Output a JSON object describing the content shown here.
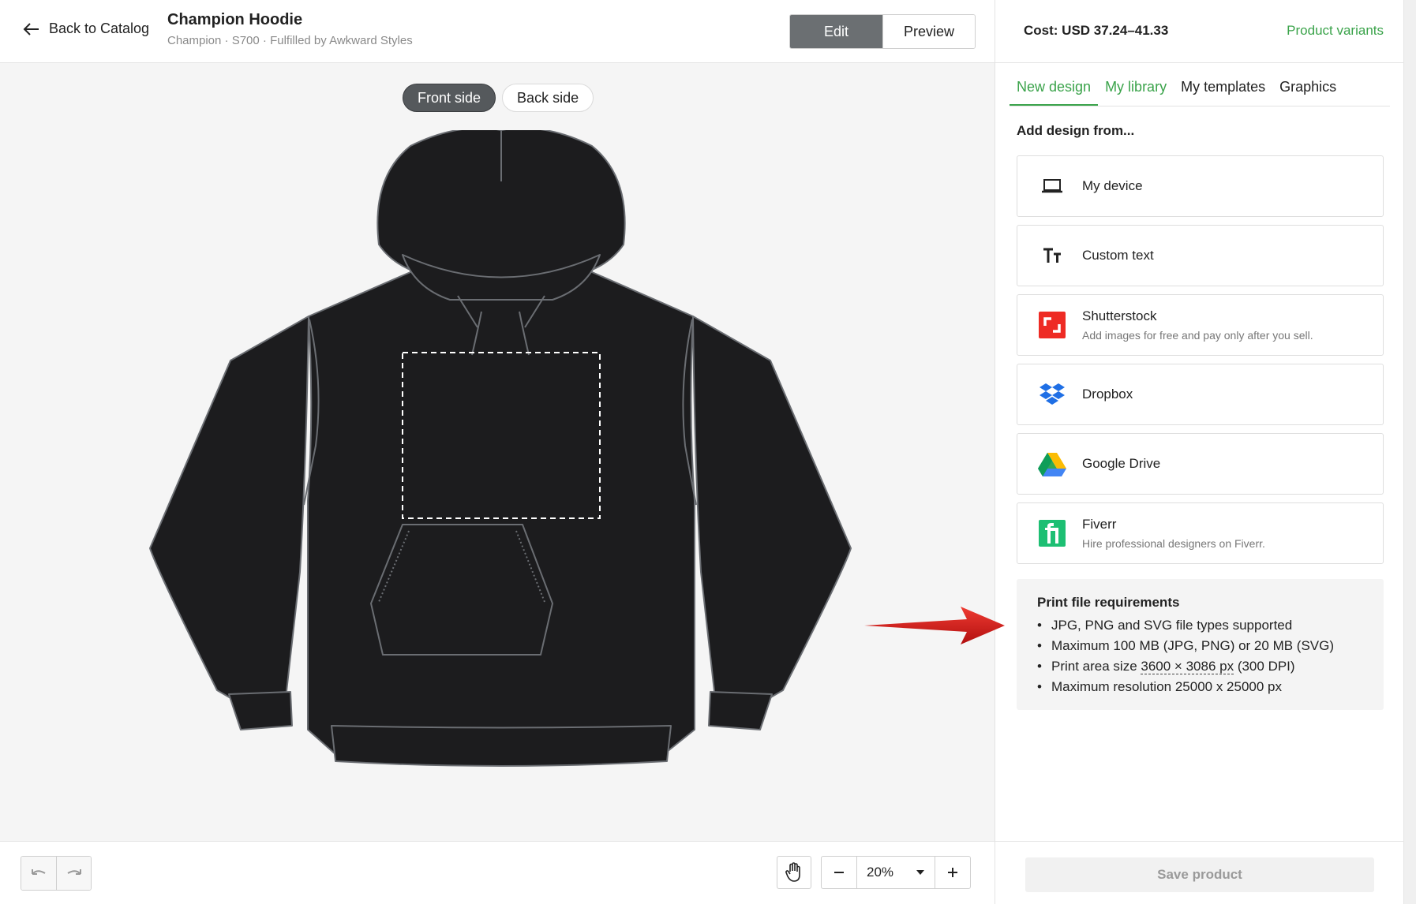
{
  "topbar": {
    "back_label": "Back to Catalog",
    "product_title": "Champion Hoodie",
    "product_subtitle": "Champion · S700 · Fulfilled by Awkward Styles",
    "edit_label": "Edit",
    "preview_label": "Preview"
  },
  "canvas": {
    "front_label": "Front side",
    "back_label": "Back side",
    "active_side": "Front side",
    "garment_color": "#1c1c1e"
  },
  "bottombar": {
    "zoom_value": "20%"
  },
  "panel": {
    "cost_label": "Cost: USD 37.24–41.33",
    "variants_label": "Product variants",
    "tabs": [
      {
        "label": "New design"
      },
      {
        "label": "My library"
      },
      {
        "label": "My templates"
      },
      {
        "label": "Graphics"
      }
    ],
    "add_design_label": "Add design from...",
    "sources": [
      {
        "name": "My device",
        "icon": "laptop-icon"
      },
      {
        "name": "Custom text",
        "icon": "text-icon"
      },
      {
        "name": "Shutterstock",
        "desc": "Add images for free and pay only after you sell.",
        "icon": "shutterstock-icon"
      },
      {
        "name": "Dropbox",
        "icon": "dropbox-icon"
      },
      {
        "name": "Google Drive",
        "icon": "google-drive-icon"
      },
      {
        "name": "Fiverr",
        "desc": "Hire professional designers on Fiverr.",
        "icon": "fiverr-icon"
      }
    ],
    "requirements": {
      "title": "Print file requirements",
      "item1": "JPG, PNG and SVG file types supported",
      "item2": "Maximum 100 MB (JPG, PNG) or 20 MB (SVG)",
      "item3_prefix": "Print area size ",
      "item3_size": "3600 × 3086 px",
      "item3_suffix": " (300 DPI)",
      "item4": "Maximum resolution 25000 x 25000 px"
    },
    "save_label": "Save product"
  },
  "colors": {
    "accent_green": "#3aa34a",
    "edit_active": "#6b6f72",
    "annotation_arrow": "#d61f1f"
  }
}
